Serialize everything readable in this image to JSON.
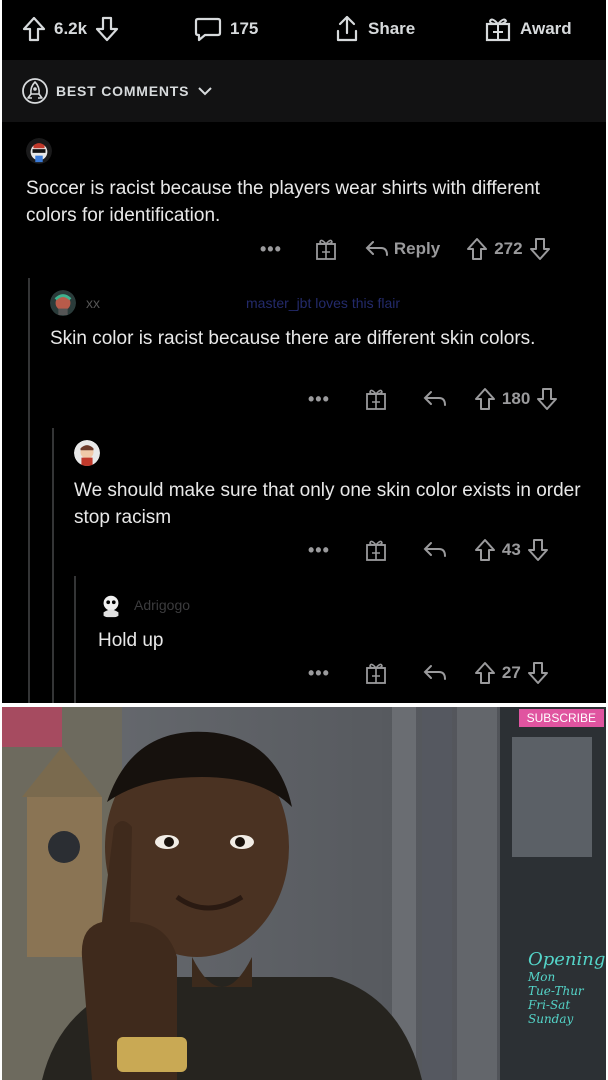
{
  "toolbar": {
    "votes": "6.2k",
    "comments": "175",
    "share": "Share",
    "award": "Award"
  },
  "sort": {
    "label": "BEST COMMENTS"
  },
  "comments": [
    {
      "text": "Soccer is racist because the players wear shirts with different colors for identification.",
      "reply": "Reply",
      "score": "272"
    },
    {
      "user": "xx",
      "flair": "master_jbt loves this flair",
      "text": "Skin color is racist because there are different skin colors.",
      "score": "180"
    },
    {
      "text": "We should make sure that only one skin color exists in order stop racism",
      "score": "43"
    },
    {
      "user": "Adrigogo",
      "text": "Hold up",
      "score": "27"
    }
  ],
  "meme": {
    "subscribe": "SUBSCRIBE",
    "sign": [
      "Opening",
      "Mon",
      "Tue-Thur",
      "Fri-Sat",
      "Sunday"
    ]
  },
  "colors": {
    "background": "#000000",
    "sortbar": "#121213",
    "text": "#d7dadc"
  }
}
